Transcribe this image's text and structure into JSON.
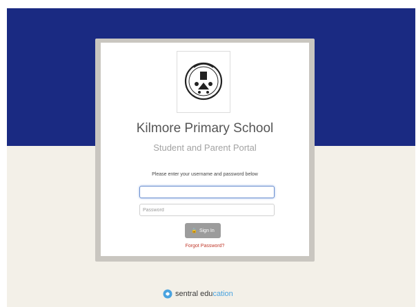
{
  "school": {
    "name": "Kilmore Primary School",
    "portal_title": "Student and Parent Portal"
  },
  "form": {
    "instruction": "Please enter your username and password below",
    "username_value": "",
    "password_placeholder": "Password",
    "signin_label": "Sign In",
    "forgot_label": "Forgot Password?"
  },
  "footer": {
    "brand_strong": "sentral edu",
    "brand_light": "cation"
  },
  "colors": {
    "header_band": "#1a2a82",
    "page_background": "#f3f0e8",
    "signin_button": "#9c9c9c",
    "forgot_link": "#c0392b"
  },
  "icons": {
    "signin": "lock-icon",
    "footer": "sentral-logo-icon",
    "crest": "school-crest-logo"
  }
}
